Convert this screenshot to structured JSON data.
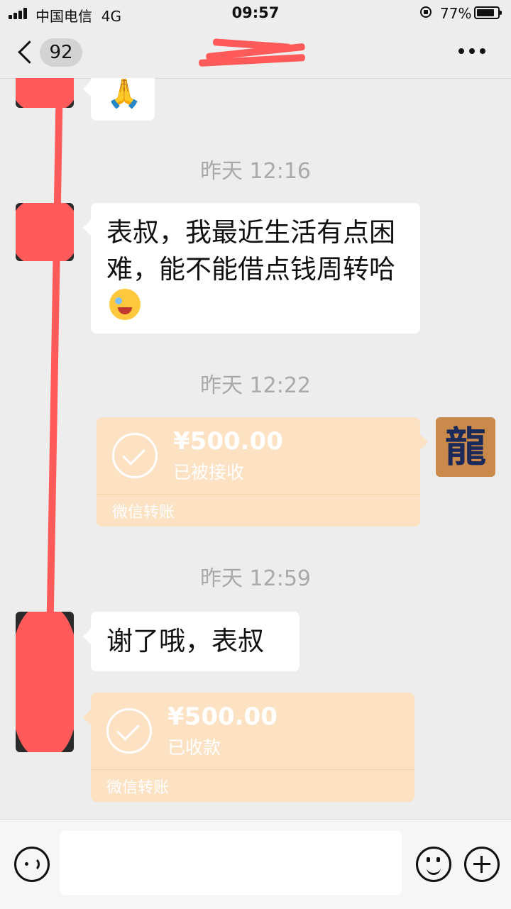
{
  "status_bar": {
    "carrier": "中国电信",
    "network": "4G",
    "time": "09:57",
    "battery_percent": "77%",
    "battery_level": 0.77
  },
  "nav": {
    "unread_count": "92"
  },
  "messages": {
    "emoji_partial": "🙏",
    "timestamp1": "昨天 12:16",
    "msg1_text": "表叔，我最近生活有点困难，能不能借点钱周转哈",
    "timestamp2": "昨天 12:22",
    "transfer1": {
      "amount": "¥500.00",
      "status": "已被接收",
      "label": "微信转账"
    },
    "my_avatar_glyph": "龍",
    "timestamp3": "昨天 12:59",
    "msg2_text": "谢了哦，表叔",
    "transfer2": {
      "amount": "¥500.00",
      "status": "已收款",
      "label": "微信转账"
    }
  },
  "colors": {
    "background": "#ededed",
    "transfer_bubble": "#fde1c3",
    "redaction": "#ff5a5a"
  },
  "icons": [
    "signal-icon",
    "chevron-left-icon",
    "more-icon",
    "voice-icon",
    "emoji-icon",
    "plus-icon",
    "check-circle-icon"
  ]
}
